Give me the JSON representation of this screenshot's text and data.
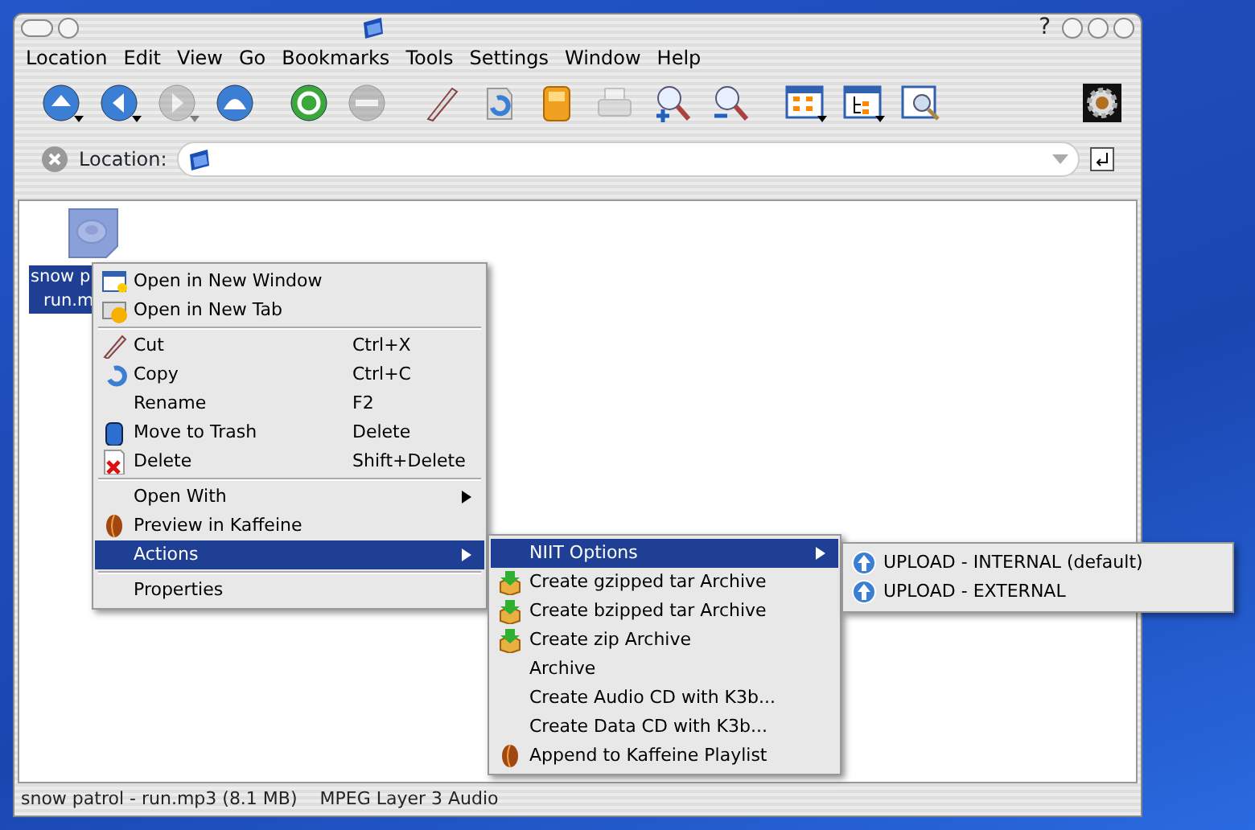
{
  "title_bar": {
    "help": "?"
  },
  "menubar": [
    "Location",
    "Edit",
    "View",
    "Go",
    "Bookmarks",
    "Tools",
    "Settings",
    "Window",
    "Help"
  ],
  "toolbar": [
    {
      "disabled": false,
      "dropdown": true
    },
    {
      "disabled": false,
      "dropdown": true
    },
    {
      "disabled": true,
      "dropdown": true
    },
    {
      "disabled": false,
      "dropdown": false
    },
    {
      "disabled": false,
      "dropdown": false
    },
    {
      "disabled": true,
      "dropdown": false
    },
    {
      "disabled": false,
      "dropdown": false
    },
    {
      "disabled": false,
      "dropdown": false
    },
    {
      "disabled": false,
      "dropdown": false
    },
    {
      "disabled": true,
      "dropdown": false
    },
    {
      "disabled": false,
      "dropdown": false
    },
    {
      "disabled": false,
      "dropdown": false
    },
    {
      "disabled": false,
      "dropdown": true
    },
    {
      "disabled": false,
      "dropdown": true
    },
    {
      "disabled": false,
      "dropdown": false
    }
  ],
  "location_bar": {
    "label": "Location:"
  },
  "file": {
    "name_lines": [
      "snow p",
      "run.m"
    ],
    "selected": true
  },
  "context_menu": [
    {
      "kind": "item",
      "label": "Open in New Window",
      "submenu": false,
      "selected": false
    },
    {
      "kind": "item",
      "label": "Open in New Tab",
      "submenu": false,
      "selected": false
    },
    {
      "kind": "separator"
    },
    {
      "kind": "item",
      "label": "Cut",
      "shortcut": "Ctrl+X",
      "submenu": false,
      "selected": false
    },
    {
      "kind": "item",
      "label": "Copy",
      "shortcut": "Ctrl+C",
      "submenu": false,
      "selected": false
    },
    {
      "kind": "item",
      "label": "Rename",
      "shortcut": "F2",
      "submenu": false,
      "selected": false
    },
    {
      "kind": "item",
      "label": "Move to Trash",
      "shortcut": "Delete",
      "submenu": false,
      "selected": false
    },
    {
      "kind": "item",
      "label": "Delete",
      "shortcut": "Shift+Delete",
      "submenu": false,
      "selected": false
    },
    {
      "kind": "separator"
    },
    {
      "kind": "item",
      "label": "Open With",
      "submenu": true,
      "selected": false
    },
    {
      "kind": "item",
      "label": "Preview in Kaffeine",
      "submenu": false,
      "selected": false
    },
    {
      "kind": "item",
      "label": "Actions",
      "submenu": true,
      "selected": true
    },
    {
      "kind": "separator"
    },
    {
      "kind": "item",
      "label": "Properties",
      "submenu": false,
      "selected": false
    }
  ],
  "actions_menu": [
    {
      "label": "NIIT Options",
      "submenu": true,
      "selected": true
    },
    {
      "label": "Create gzipped tar Archive",
      "submenu": false,
      "selected": false
    },
    {
      "label": "Create bzipped tar Archive",
      "submenu": false,
      "selected": false
    },
    {
      "label": "Create zip Archive",
      "submenu": false,
      "selected": false
    },
    {
      "label": "Archive",
      "submenu": false,
      "selected": false
    },
    {
      "label": "Create Audio CD with K3b...",
      "submenu": false,
      "selected": false
    },
    {
      "label": "Create Data CD with K3b...",
      "submenu": false,
      "selected": false
    },
    {
      "label": "Append to Kaffeine Playlist",
      "submenu": false,
      "selected": false
    }
  ],
  "niit_menu": [
    {
      "label": "UPLOAD - INTERNAL (default)",
      "selected": false
    },
    {
      "label": "UPLOAD - EXTERNAL",
      "selected": false
    }
  ],
  "status_bar": [
    "snow patrol - run.mp3 (8.1 MB)",
    "MPEG Layer 3 Audio"
  ]
}
